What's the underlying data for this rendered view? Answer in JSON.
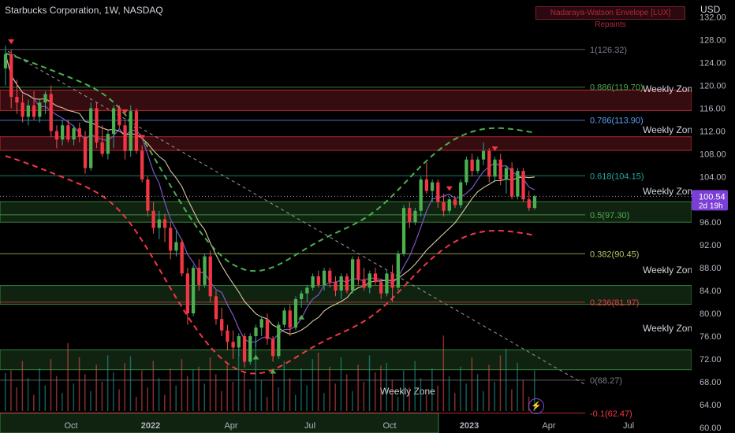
{
  "header": {
    "title": "Starbucks Corporation, 1W, NASDAQ"
  },
  "indicator_badge": "Nadaraya-Watson Envelope [LUX] Repaints",
  "currency": "USD",
  "price_tag": {
    "value": "100.54",
    "countdown": "2d 19h"
  },
  "chart_data": {
    "type": "candlestick",
    "title": "Starbucks Corporation, 1W, NASDAQ",
    "x_tick_labels": [
      "Oct",
      "2022",
      "Apr",
      "Jul",
      "Oct",
      "2023",
      "Apr",
      "Jul"
    ],
    "y_tick_labels": [
      "132.00",
      "128.00",
      "124.00",
      "120.00",
      "116.00",
      "112.00",
      "108.00",
      "104.00",
      "100.00",
      "96.00",
      "92.00",
      "88.00",
      "84.00",
      "80.00",
      "76.00",
      "72.00",
      "68.00",
      "64.00",
      "60.00"
    ],
    "ylim": [
      59,
      135
    ],
    "last_price": 100.54,
    "fibonacci": [
      {
        "label": "1(126.32)",
        "value": 126.32,
        "color": "#787b86"
      },
      {
        "label": "0.886(119.70)",
        "value": 119.7,
        "color": "#4caf50"
      },
      {
        "label": "0.786(113.90)",
        "value": 113.9,
        "color": "#5b9cf6"
      },
      {
        "label": "0.618(104.15)",
        "value": 104.15,
        "color": "#26a69a"
      },
      {
        "label": "0.5(97.30)",
        "value": 97.3,
        "color": "#4caf50"
      },
      {
        "label": "0.382(90.45)",
        "value": 90.45,
        "color": "#b5c46b"
      },
      {
        "label": "0.236(81.97)",
        "value": 81.97,
        "color": "#f23645"
      },
      {
        "label": "0(68.27)",
        "value": 68.27,
        "color": "#787b86"
      },
      {
        "label": "-0.1(62.47)",
        "value": 62.47,
        "color": "#f23645"
      }
    ],
    "zones": [
      {
        "label": "Weekly Zone",
        "top": 119.2,
        "bottom": 115.6,
        "color": "#f23645"
      },
      {
        "label": "Weekly Zone",
        "top": 111.0,
        "bottom": 108.6,
        "color": "#f23645"
      },
      {
        "label": "Weekly Zone",
        "top": 99.6,
        "bottom": 96.0,
        "color": "#4caf50"
      },
      {
        "label": "Weekly Zone",
        "top": 84.9,
        "bottom": 81.6,
        "color": "#4caf50"
      },
      {
        "label": "Weekly Zone",
        "top": 73.6,
        "bottom": 70.1,
        "color": "#4caf50"
      },
      {
        "label": "Weekly Zone",
        "top": 62.5,
        "bottom": 59.0,
        "color": "#4caf50"
      }
    ],
    "candles": [
      [
        123.0,
        127.0,
        120.0,
        125.5
      ],
      [
        125.5,
        126.3,
        116.0,
        118.0
      ],
      [
        118.0,
        121.0,
        115.0,
        117.0
      ],
      [
        117.0,
        118.5,
        113.5,
        114.5
      ],
      [
        114.5,
        117.5,
        113.0,
        116.5
      ],
      [
        116.5,
        119.0,
        114.0,
        114.5
      ],
      [
        114.5,
        117.5,
        113.5,
        117.0
      ],
      [
        117.0,
        119.0,
        115.0,
        118.5
      ],
      [
        118.5,
        120.0,
        111.0,
        112.0
      ],
      [
        112.0,
        113.0,
        109.0,
        110.5
      ],
      [
        110.5,
        114.0,
        109.5,
        113.0
      ],
      [
        113.0,
        114.0,
        110.0,
        110.5
      ],
      [
        110.5,
        113.0,
        109.5,
        112.5
      ],
      [
        112.5,
        113.5,
        110.0,
        111.0
      ],
      [
        111.0,
        112.0,
        104.5,
        105.5
      ],
      [
        105.5,
        117.0,
        105.0,
        116.0
      ],
      [
        116.0,
        117.0,
        109.0,
        110.0
      ],
      [
        110.0,
        113.0,
        107.5,
        108.0
      ],
      [
        108.0,
        112.0,
        107.0,
        111.5
      ],
      [
        111.5,
        116.5,
        109.0,
        116.0
      ],
      [
        116.0,
        116.5,
        112.5,
        113.0
      ],
      [
        113.0,
        114.0,
        107.0,
        108.5
      ],
      [
        108.5,
        116.5,
        107.5,
        115.5
      ],
      [
        115.5,
        116.0,
        108.0,
        108.5
      ],
      [
        108.5,
        109.5,
        103.0,
        103.5
      ],
      [
        103.5,
        104.0,
        97.0,
        98.0
      ],
      [
        98.0,
        99.5,
        94.0,
        95.0
      ],
      [
        95.0,
        98.0,
        93.0,
        96.5
      ],
      [
        96.5,
        97.5,
        92.5,
        95.0
      ],
      [
        95.0,
        96.0,
        89.5,
        91.0
      ],
      [
        91.0,
        94.5,
        90.0,
        92.5
      ],
      [
        92.5,
        93.0,
        86.5,
        87.0
      ],
      [
        87.0,
        88.0,
        78.0,
        80.0
      ],
      [
        80.0,
        88.5,
        79.5,
        88.0
      ],
      [
        88.0,
        89.5,
        84.0,
        85.0
      ],
      [
        85.0,
        90.5,
        84.5,
        90.0
      ],
      [
        90.0,
        91.0,
        82.0,
        83.0
      ],
      [
        83.0,
        84.0,
        78.0,
        79.0
      ],
      [
        79.0,
        81.0,
        76.0,
        77.0
      ],
      [
        77.0,
        78.0,
        73.5,
        75.0
      ],
      [
        75.0,
        77.0,
        72.0,
        74.0
      ],
      [
        74.0,
        76.5,
        72.5,
        76.0
      ],
      [
        76.0,
        76.5,
        70.5,
        71.5
      ],
      [
        71.5,
        76.5,
        71.0,
        76.0
      ],
      [
        76.0,
        78.0,
        74.0,
        77.5
      ],
      [
        77.5,
        79.5,
        76.0,
        79.0
      ],
      [
        79.0,
        80.0,
        74.5,
        75.5
      ],
      [
        75.5,
        76.0,
        71.5,
        72.5
      ],
      [
        72.5,
        78.5,
        72.0,
        78.0
      ],
      [
        78.0,
        81.0,
        77.5,
        80.5
      ],
      [
        80.5,
        81.5,
        76.0,
        77.5
      ],
      [
        77.5,
        83.0,
        77.0,
        82.5
      ],
      [
        82.5,
        84.0,
        81.0,
        83.5
      ],
      [
        83.5,
        85.0,
        82.0,
        84.5
      ],
      [
        84.5,
        87.0,
        84.0,
        86.5
      ],
      [
        86.5,
        87.5,
        84.5,
        85.0
      ],
      [
        85.0,
        88.0,
        84.0,
        87.5
      ],
      [
        87.5,
        88.0,
        84.5,
        85.5
      ],
      [
        85.5,
        86.5,
        83.0,
        84.0
      ],
      [
        84.0,
        87.0,
        82.5,
        86.5
      ],
      [
        86.5,
        87.0,
        83.5,
        84.0
      ],
      [
        84.0,
        90.0,
        83.5,
        89.5
      ],
      [
        89.5,
        90.0,
        85.0,
        86.0
      ],
      [
        86.0,
        88.0,
        84.0,
        84.5
      ],
      [
        84.5,
        87.5,
        83.5,
        87.0
      ],
      [
        87.0,
        88.0,
        85.0,
        85.5
      ],
      [
        85.5,
        86.0,
        82.5,
        83.5
      ],
      [
        83.5,
        87.5,
        83.0,
        87.0
      ],
      [
        87.0,
        88.5,
        82.0,
        84.5
      ],
      [
        84.5,
        91.0,
        84.0,
        90.5
      ],
      [
        90.5,
        99.0,
        90.0,
        98.5
      ],
      [
        98.5,
        99.5,
        95.0,
        96.0
      ],
      [
        96.0,
        98.5,
        95.5,
        98.0
      ],
      [
        98.0,
        104.0,
        97.0,
        103.5
      ],
      [
        103.5,
        106.5,
        101.0,
        101.5
      ],
      [
        101.5,
        103.5,
        99.5,
        103.0
      ],
      [
        103.0,
        103.5,
        98.5,
        99.5
      ],
      [
        99.5,
        101.0,
        97.0,
        98.0
      ],
      [
        98.0,
        100.5,
        97.5,
        100.0
      ],
      [
        100.0,
        100.5,
        98.5,
        99.0
      ],
      [
        99.0,
        103.5,
        98.5,
        103.0
      ],
      [
        103.0,
        107.5,
        102.5,
        107.0
      ],
      [
        107.0,
        108.0,
        104.0,
        105.0
      ],
      [
        105.0,
        107.5,
        104.5,
        107.0
      ],
      [
        107.0,
        110.0,
        106.0,
        108.5
      ],
      [
        108.5,
        109.0,
        103.0,
        104.0
      ],
      [
        104.0,
        107.5,
        103.0,
        107.0
      ],
      [
        107.0,
        108.0,
        102.5,
        103.5
      ],
      [
        103.5,
        106.0,
        101.0,
        105.5
      ],
      [
        105.5,
        106.5,
        100.0,
        100.5
      ],
      [
        100.5,
        105.5,
        100.0,
        105.0
      ],
      [
        105.0,
        105.5,
        99.5,
        100.0
      ],
      [
        100.0,
        101.5,
        98.0,
        98.5
      ],
      [
        98.5,
        100.8,
        98.2,
        100.54
      ]
    ],
    "signals": [
      {
        "type": "sell",
        "index": 1
      },
      {
        "type": "sell",
        "index": 21
      },
      {
        "type": "sell",
        "index": 24
      },
      {
        "type": "buy",
        "index": 44
      },
      {
        "type": "buy",
        "index": 47
      },
      {
        "type": "buy",
        "index": 52
      },
      {
        "type": "sell",
        "index": 78
      },
      {
        "type": "sell",
        "index": 86
      }
    ]
  }
}
